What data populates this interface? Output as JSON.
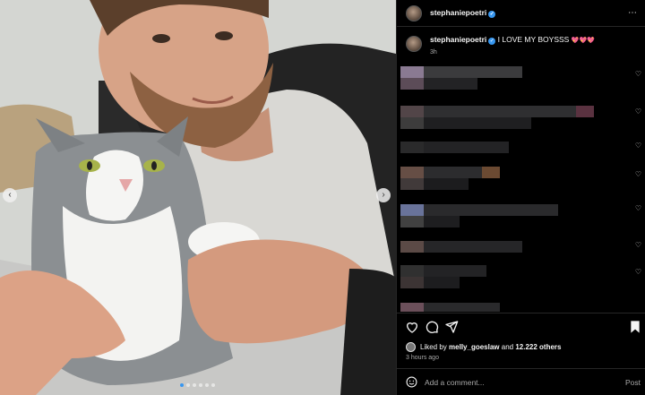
{
  "post": {
    "username": "stephaniepoetri",
    "caption_text": "I LOVE MY BOYSSS",
    "caption_emoji": "💖💖💖",
    "caption_time": "3h",
    "liked_by_prefix": "Liked by",
    "liked_by_user": "melly_goeslaw",
    "liked_by_connector": "and",
    "liked_by_others": "12.222 others",
    "posted_ago": "3 hours ago",
    "comment_placeholder": "Add a comment...",
    "post_button": "Post",
    "more_icon": "⋯",
    "carousel_count": 6,
    "carousel_active": 1
  },
  "icons": {
    "verified": "✓",
    "prev": "‹",
    "next": "›",
    "heart_small": "♡"
  },
  "colors": {
    "accent": "#3797f0",
    "caption_hearts": "#e0245e"
  }
}
